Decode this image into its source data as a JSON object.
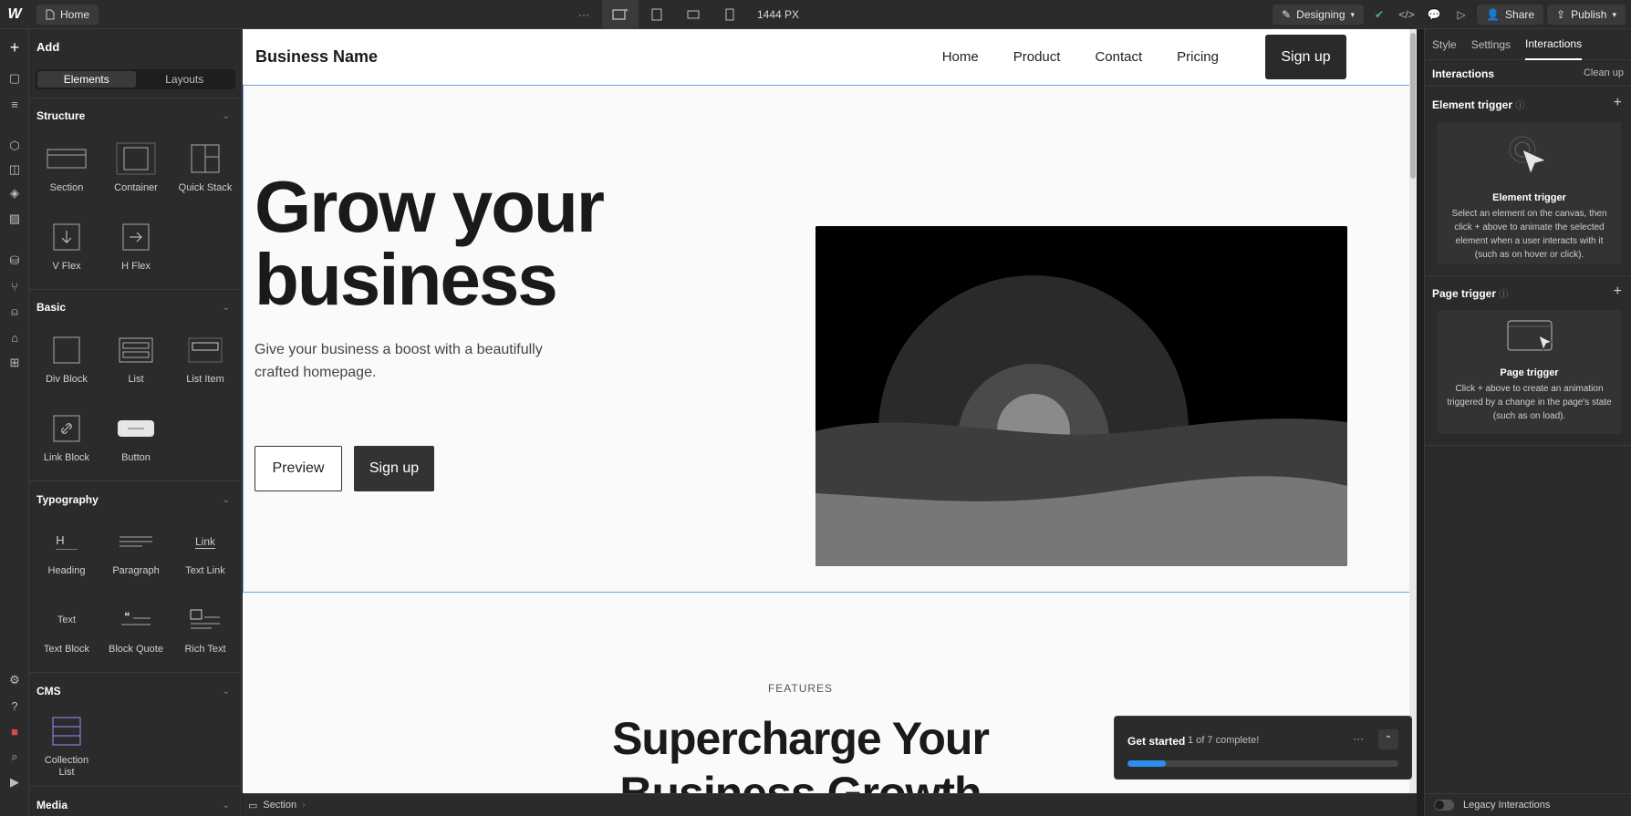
{
  "topbar": {
    "logo": "W",
    "page": "Home",
    "more": "···",
    "width_readout": "1444 PX",
    "mode": "Designing",
    "share": "Share",
    "publish": "Publish"
  },
  "add_panel": {
    "title": "Add",
    "tabs": [
      "Elements",
      "Layouts"
    ],
    "sections": {
      "structure": {
        "title": "Structure",
        "items": [
          "Section",
          "Container",
          "Quick Stack",
          "V Flex",
          "H Flex"
        ]
      },
      "basic": {
        "title": "Basic",
        "items": [
          "Div Block",
          "List",
          "List Item",
          "Link Block",
          "Button"
        ]
      },
      "typography": {
        "title": "Typography",
        "items": [
          "Heading",
          "Paragraph",
          "Text Link",
          "Text Block",
          "Block Quote",
          "Rich Text"
        ]
      },
      "cms": {
        "title": "CMS",
        "items": [
          "Collection List"
        ]
      },
      "media": {
        "title": "Media"
      }
    },
    "icon_text": {
      "heading": "H",
      "link": "Link",
      "text": "Text"
    }
  },
  "canvas": {
    "brand": "Business Name",
    "nav": [
      "Home",
      "Product",
      "Contact",
      "Pricing"
    ],
    "nav_cta": "Sign up",
    "hero_title_1": "Grow your",
    "hero_title_2": "business",
    "hero_sub": "Give your business a boost with a beautifully crafted homepage.",
    "btn_preview": "Preview",
    "btn_signup": "Sign up",
    "features_label": "FEATURES",
    "features_title_1": "Supercharge Your",
    "features_title_2": "Business Growth"
  },
  "toast": {
    "title": "Get started",
    "progress_text": "1 of 7 complete!",
    "progress_fraction": 0.143
  },
  "statusbar": {
    "breadcrumb": "Section"
  },
  "right_panel": {
    "tabs": [
      "Style",
      "Settings",
      "Interactions"
    ],
    "header": "Interactions",
    "clean_up": "Clean up",
    "element_trigger": {
      "title": "Element trigger",
      "card_title": "Element trigger",
      "desc": "Select an element on the canvas, then click + above to animate the selected element when a user interacts with it (such as on hover or click)."
    },
    "page_trigger": {
      "title": "Page trigger",
      "card_title": "Page trigger",
      "desc": "Click + above to create an animation triggered by a change in the page's state (such as on load)."
    },
    "legacy": "Legacy Interactions"
  },
  "colors": {
    "accent": "#2d8cf0",
    "selection": "#6aa8e0",
    "success": "#3fbf6e"
  }
}
